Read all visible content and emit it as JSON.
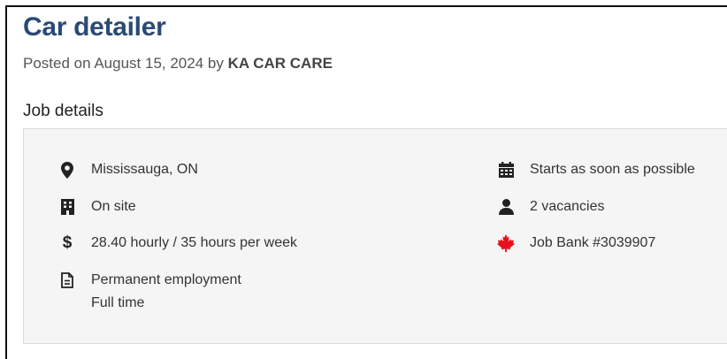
{
  "post": {
    "title": "Car detailer",
    "posted_prefix": "Posted on August 15, 2024 by",
    "employer": "KA CAR CARE"
  },
  "job_details": {
    "heading": "Job details",
    "left": [
      {
        "icon": "location-pin-icon",
        "text": "Mississauga, ON"
      },
      {
        "icon": "building-icon",
        "text": "On site"
      },
      {
        "icon": "dollar-icon",
        "text": "28.40 hourly / 35 hours per week"
      },
      {
        "icon": "document-icon",
        "text": "Permanent employment",
        "text2": "Full time"
      }
    ],
    "right": [
      {
        "icon": "calendar-icon",
        "text": "Starts as soon as possible"
      },
      {
        "icon": "person-icon",
        "text": "2 vacancies"
      },
      {
        "icon": "maple-leaf-icon",
        "text": "Job Bank #3039907"
      }
    ]
  },
  "colors": {
    "title": "#2b4a73",
    "maple_leaf": "#e8101c",
    "panel_bg": "#f5f5f5"
  }
}
